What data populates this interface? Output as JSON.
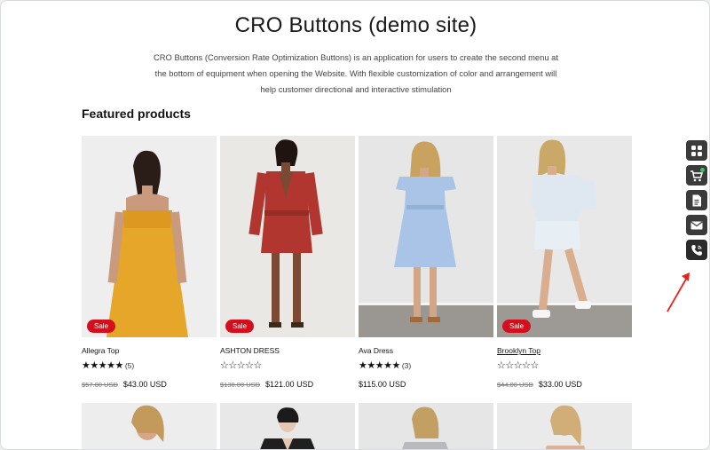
{
  "page": {
    "title": "CRO Buttons (demo site)",
    "description": "CRO Buttons (Conversion Rate Optimization Buttons) is an application for users to create the second menu at the bottom of equipment when opening the Website. With flexible customization  of color and arrangement will help customer directional and interactive stimulation"
  },
  "featured": {
    "title": "Featured products",
    "products": [
      {
        "name": "Allegra Top",
        "stars": "★★★★★",
        "rating_count": "(5)",
        "sale_badge": "Sale",
        "old_price": "$57.00 USD",
        "price": "$43.00 USD"
      },
      {
        "name": "ASHTON DRESS",
        "stars": "☆☆☆☆☆",
        "rating_count": "",
        "sale_badge": "Sale",
        "old_price": "$130.00 USD",
        "price": "$121.00 USD"
      },
      {
        "name": "Ava Dress",
        "stars": "★★★★★",
        "rating_count": "(3)",
        "sale_badge": "",
        "old_price": "",
        "price": "$115.00 USD"
      },
      {
        "name": "Brooklyn Top",
        "stars": "☆☆☆☆☆",
        "rating_count": "",
        "sale_badge": "Sale",
        "old_price": "$44.00 USD",
        "price": "$33.00 USD"
      }
    ]
  },
  "cro_buttons": [
    {
      "icon": "grid-icon"
    },
    {
      "icon": "cart-icon"
    },
    {
      "icon": "document-icon"
    },
    {
      "icon": "mail-icon"
    },
    {
      "icon": "phone-icon"
    }
  ],
  "colors": {
    "sale": "#d40f1d",
    "cro_bg": "#3b3b3b",
    "arrow": "#e8221b"
  }
}
